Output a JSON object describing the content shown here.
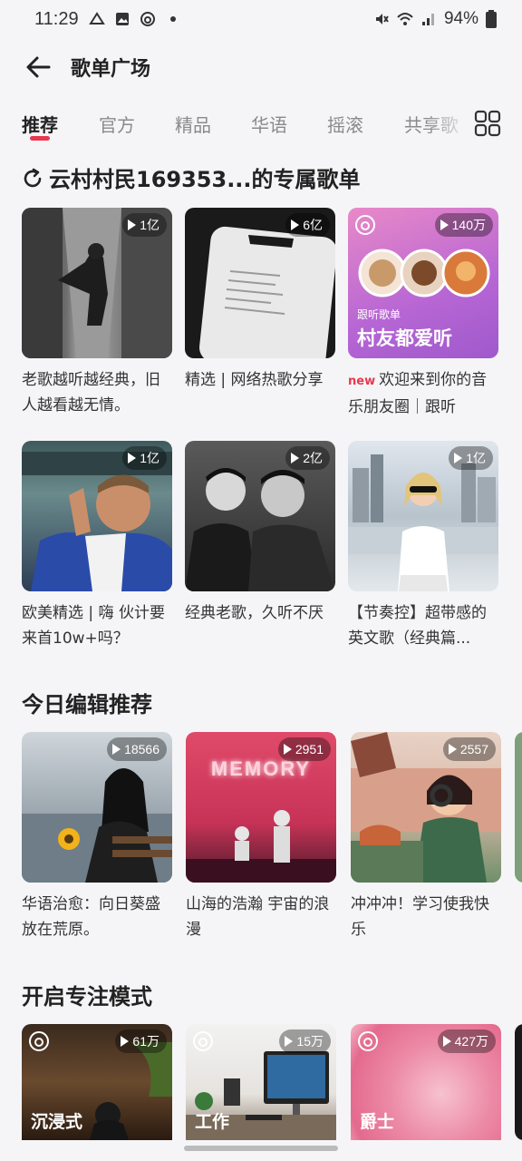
{
  "status_bar": {
    "time": "11:29",
    "battery": "94%"
  },
  "header": {
    "title": "歌单广场"
  },
  "tabs": [
    "推荐",
    "官方",
    "精品",
    "华语",
    "摇滚",
    "共享歌"
  ],
  "section1": {
    "title": "云村村民169353...的专属歌单",
    "cards": [
      {
        "count": "1亿",
        "title": "老歌越听越经典，旧人越看越无情。"
      },
      {
        "count": "6亿",
        "title": "精选 | 网络热歌分享"
      },
      {
        "count": "140万",
        "tag": "new",
        "title": "欢迎来到你的音乐朋友圈｜跟听",
        "cover_sub": "跟听歌单",
        "cover_main": "村友都爱听"
      },
      {
        "count": "1亿",
        "title": "欧美精选 | 嗨 伙计要来首10w+吗？"
      },
      {
        "count": "2亿",
        "title": "经典老歌，久听不厌"
      },
      {
        "count": "1亿",
        "title": "【节奏控】超带感的英文歌（经典篇..."
      }
    ]
  },
  "section2": {
    "title": "今日编辑推荐",
    "cards": [
      {
        "count": "18566",
        "title": "华语治愈：向日葵盛放在荒原。"
      },
      {
        "count": "2951",
        "title": "山海的浩瀚 宇宙的浪漫",
        "cover_text": "MEMORY"
      },
      {
        "count": "2557",
        "title": "冲冲冲！学习使我快乐"
      }
    ]
  },
  "section3": {
    "title": "开启专注模式",
    "cards": [
      {
        "count": "61万",
        "label": "沉浸式"
      },
      {
        "count": "15万",
        "label": "工作"
      },
      {
        "count": "427万",
        "label": "爵士"
      }
    ]
  }
}
